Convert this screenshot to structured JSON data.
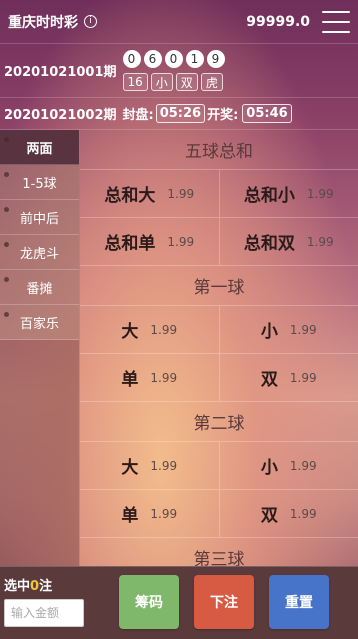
{
  "header": {
    "title": "重庆时时彩",
    "info_icon": "ⓘ",
    "balance": "99999.0"
  },
  "draw": {
    "period": "20201021001期",
    "balls": [
      "0",
      "6",
      "0",
      "1",
      "9"
    ],
    "tags": [
      "16",
      "小",
      "双",
      "虎"
    ]
  },
  "next": {
    "period": "20201021002期",
    "close_label": "封盘:",
    "close_time": "05:26",
    "open_label": "开奖:",
    "open_time": "05:46"
  },
  "sidebar": {
    "items": [
      {
        "label": "两面",
        "active": true
      },
      {
        "label": "1-5球",
        "active": false
      },
      {
        "label": "前中后",
        "active": false
      },
      {
        "label": "龙虎斗",
        "active": false
      },
      {
        "label": "番摊",
        "active": false
      },
      {
        "label": "百家乐",
        "active": false
      }
    ]
  },
  "sections": [
    {
      "title": "五球总和",
      "rows": [
        [
          {
            "name": "总和大",
            "odds": "1.99"
          },
          {
            "name": "总和小",
            "odds": "1.99"
          }
        ],
        [
          {
            "name": "总和单",
            "odds": "1.99"
          },
          {
            "name": "总和双",
            "odds": "1.99"
          }
        ]
      ]
    },
    {
      "title": "第一球",
      "rows": [
        [
          {
            "name": "大",
            "odds": "1.99"
          },
          {
            "name": "小",
            "odds": "1.99"
          }
        ],
        [
          {
            "name": "单",
            "odds": "1.99"
          },
          {
            "name": "双",
            "odds": "1.99"
          }
        ]
      ]
    },
    {
      "title": "第二球",
      "rows": [
        [
          {
            "name": "大",
            "odds": "1.99"
          },
          {
            "name": "小",
            "odds": "1.99"
          }
        ],
        [
          {
            "name": "单",
            "odds": "1.99"
          },
          {
            "name": "双",
            "odds": "1.99"
          }
        ]
      ]
    },
    {
      "title": "第三球",
      "rows": []
    }
  ],
  "footer": {
    "selected_prefix": "选中",
    "selected_count": "0",
    "selected_suffix": "注",
    "amount_placeholder": "输入金额",
    "chips_label": "筹码",
    "bet_label": "下注",
    "reset_label": "重置"
  },
  "colors": {
    "count_highlight": "#f6c33b",
    "chips_button": "#7fb86b",
    "bet_button": "#d75a43",
    "reset_button": "#4773c9"
  }
}
